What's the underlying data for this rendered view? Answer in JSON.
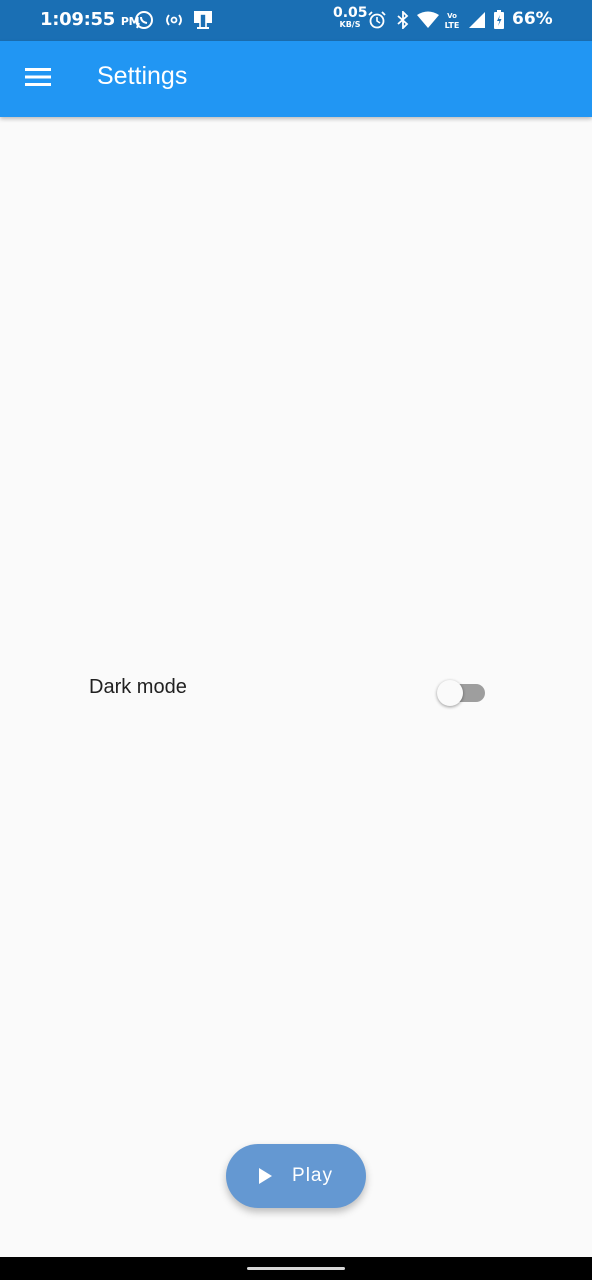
{
  "status_bar": {
    "time": "1:09:55",
    "ampm": "PM",
    "net_speed_value": "0.05",
    "net_speed_unit": "KB/S",
    "battery_percent": "66%",
    "icons": [
      "whatsapp-icon",
      "hotspot-icon",
      "screencast-icon",
      "alarm-icon",
      "bluetooth-icon",
      "wifi-icon",
      "volte-icon",
      "signal-icon",
      "battery-icon"
    ]
  },
  "app_bar": {
    "title": "Settings",
    "menu_icon": "hamburger-menu-icon",
    "background_color": "#2196f3"
  },
  "settings": {
    "dark_mode_label": "Dark mode",
    "dark_mode_enabled": false
  },
  "fab": {
    "label": "Play",
    "icon": "play-icon",
    "color": "#6498d2"
  }
}
